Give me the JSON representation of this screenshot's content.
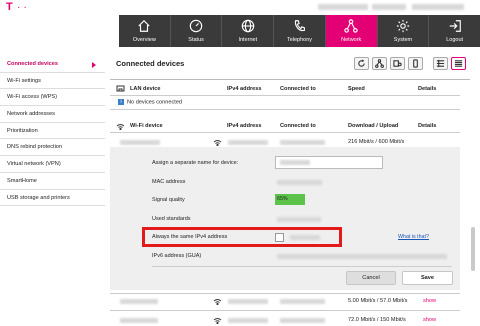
{
  "brand": {
    "logo": "T",
    "dots": "· ·"
  },
  "nav": [
    {
      "label": "Overview",
      "icon": "home-icon"
    },
    {
      "label": "Status",
      "icon": "gauge-icon"
    },
    {
      "label": "Internet",
      "icon": "globe-icon"
    },
    {
      "label": "Telephony",
      "icon": "phone-icon"
    },
    {
      "label": "Network",
      "icon": "network-icon",
      "active": true
    },
    {
      "label": "System",
      "icon": "gear-icon"
    },
    {
      "label": "Logout",
      "icon": "logout-icon"
    }
  ],
  "sidebar": [
    {
      "label": "Connected devices",
      "active": true
    },
    {
      "label": "Wi-Fi settings"
    },
    {
      "label": "Wi-Fi access (WPS)"
    },
    {
      "label": "Network addresses"
    },
    {
      "label": "Prioritization"
    },
    {
      "label": "DNS rebind protection"
    },
    {
      "label": "Virtual network (VPN)"
    },
    {
      "label": "SmartHome"
    },
    {
      "label": "USB storage and printers"
    }
  ],
  "main": {
    "title": "Connected devices",
    "lan_headers": [
      "LAN device",
      "IPv4 address",
      "Connected to",
      "Speed",
      "Details"
    ],
    "lan_empty": "No devices connected",
    "wifi_headers": [
      "Wi-Fi device",
      "IPv4 address",
      "Connected to",
      "Download / Upload",
      "Details"
    ],
    "wifi_rows": [
      {
        "speed": "216 Mbit/s",
        "upload": "600 Mbit/s"
      },
      {
        "speed": "5.00 Mbit/s",
        "upload": "57.0 Mbit/s",
        "details": "show"
      },
      {
        "speed": "72.0 Mbit/s",
        "upload": "150 Mbit/s",
        "details": "show"
      }
    ],
    "detail_labels": {
      "name": "Assign a separate name for device:",
      "mac": "MAC address",
      "signal": "Signal quality",
      "standards": "Used standards",
      "same_ip": "Always the same IPv4 address",
      "ipv6": "IPv6 address (GUA)"
    },
    "signal_value": "65%",
    "what_is_that": "What is that?",
    "cancel": "Cancel",
    "save": "Save"
  },
  "colors": {
    "magenta": "#e20074",
    "nav": "#3a3a3a",
    "highlight": "#e21a1a",
    "signal": "#5cc24a"
  }
}
